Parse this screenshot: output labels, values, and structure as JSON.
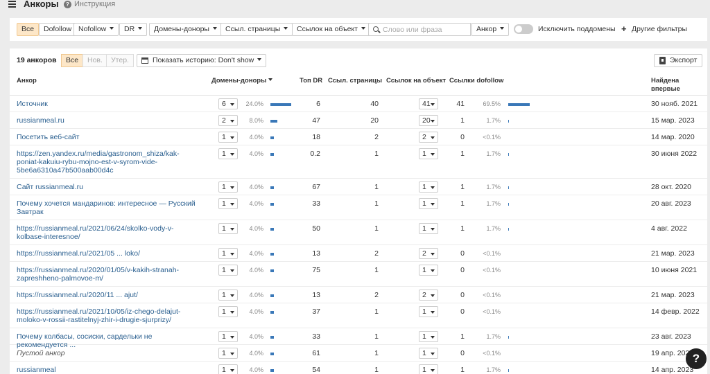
{
  "header": {
    "title": "Анкоры",
    "help_label": "Инструкция"
  },
  "filters": {
    "all": "Все",
    "dofollow": "Dofollow",
    "nofollow": "Nofollow",
    "dr": "DR",
    "ref_domains": "Домены-доноры",
    "ref_pages": "Ссыл. страницы",
    "links_to_target": "Ссылок на объект",
    "search_placeholder": "Слово или фраза",
    "search_value": "",
    "search_mode": "Анкор",
    "exclude_subdomains": "Исключить поддомены",
    "more_filters": "Другие фильтры"
  },
  "toolbar": {
    "count": "19 анкоров",
    "seg_all": "Все",
    "seg_new": "Нов.",
    "seg_lost": "Утер.",
    "history": "Показать историю: Don't show",
    "export": "Экспорт"
  },
  "table": {
    "columns": {
      "anchor": "Анкор",
      "ref_domains": "Домены-доноры",
      "dr": "Топ DR",
      "ref_pages": "Ссыл. страницы",
      "links_to_target": "Ссылок на объект",
      "dofollow": "Ссылки dofollow",
      "first_seen": "Найдена впервые"
    },
    "rows": [
      {
        "anchor": "Источник",
        "domains": "6",
        "domains_pct": "24.0%",
        "domains_frac": 0.24,
        "dr": "6",
        "pages": "40",
        "links": "41",
        "dofollow": "41",
        "dofollow_pct": "69.5%",
        "dofollow_frac": 0.695,
        "date": "30 нояб. 2021"
      },
      {
        "anchor": "russianmeal.ru",
        "domains": "2",
        "domains_pct": "8.0%",
        "domains_frac": 0.08,
        "dr": "47",
        "pages": "20",
        "links": "20",
        "dofollow": "1",
        "dofollow_pct": "1.7%",
        "dofollow_frac": 0.017,
        "date": "15 мар. 2023"
      },
      {
        "anchor": "Посетить веб-сайт",
        "domains": "1",
        "domains_pct": "4.0%",
        "domains_frac": 0.04,
        "dr": "18",
        "pages": "2",
        "links": "2",
        "dofollow": "0",
        "dofollow_pct": "<0.1%",
        "dofollow_frac": 0,
        "date": "14 мар. 2020"
      },
      {
        "anchor": "https://zen.yandex.ru/media/gastronom_shiza/kak-poniat-kakuiu-rybu-mojno-est-v-syrom-vide-5be6a6310a47b500aab00d4c",
        "domains": "1",
        "domains_pct": "4.0%",
        "domains_frac": 0.04,
        "dr": "0.2",
        "pages": "1",
        "links": "1",
        "dofollow": "1",
        "dofollow_pct": "1.7%",
        "dofollow_frac": 0.017,
        "date": "30 июня 2022"
      },
      {
        "anchor": "Сайт russianmeal.ru",
        "domains": "1",
        "domains_pct": "4.0%",
        "domains_frac": 0.04,
        "dr": "67",
        "pages": "1",
        "links": "1",
        "dofollow": "1",
        "dofollow_pct": "1.7%",
        "dofollow_frac": 0.017,
        "date": "28 окт. 2020"
      },
      {
        "anchor": "Почему хочется мандаринов: интересное — Русский Завтрак",
        "domains": "1",
        "domains_pct": "4.0%",
        "domains_frac": 0.04,
        "dr": "33",
        "pages": "1",
        "links": "1",
        "dofollow": "1",
        "dofollow_pct": "1.7%",
        "dofollow_frac": 0.017,
        "date": "20 авг. 2023"
      },
      {
        "anchor": "https://russianmeal.ru/2021/06/24/skolko-vody-v-kolbase-interesnoe/",
        "domains": "1",
        "domains_pct": "4.0%",
        "domains_frac": 0.04,
        "dr": "50",
        "pages": "1",
        "links": "1",
        "dofollow": "1",
        "dofollow_pct": "1.7%",
        "dofollow_frac": 0.017,
        "date": "4 авг. 2022"
      },
      {
        "anchor": "https://russianmeal.ru/2021/05 ... loko/",
        "domains": "1",
        "domains_pct": "4.0%",
        "domains_frac": 0.04,
        "dr": "13",
        "pages": "2",
        "links": "2",
        "dofollow": "0",
        "dofollow_pct": "<0.1%",
        "dofollow_frac": 0,
        "date": "21 мар. 2023"
      },
      {
        "anchor": "https://russianmeal.ru/2020/01/05/v-kakih-stranah-zapreshheno-palmovoe-m/",
        "domains": "1",
        "domains_pct": "4.0%",
        "domains_frac": 0.04,
        "dr": "75",
        "pages": "1",
        "links": "1",
        "dofollow": "0",
        "dofollow_pct": "<0.1%",
        "dofollow_frac": 0,
        "date": "10 июня 2021"
      },
      {
        "anchor": "https://russianmeal.ru/2020/11 ... ajut/",
        "domains": "1",
        "domains_pct": "4.0%",
        "domains_frac": 0.04,
        "dr": "13",
        "pages": "2",
        "links": "2",
        "dofollow": "0",
        "dofollow_pct": "<0.1%",
        "dofollow_frac": 0,
        "date": "21 мар. 2023"
      },
      {
        "anchor": "https://russianmeal.ru/2021/10/05/iz-chego-delajut-moloko-v-rossii-rastitelnyj-zhir-i-drugie-sjurprizy/",
        "domains": "1",
        "domains_pct": "4.0%",
        "domains_frac": 0.04,
        "dr": "37",
        "pages": "1",
        "links": "1",
        "dofollow": "0",
        "dofollow_pct": "<0.1%",
        "dofollow_frac": 0,
        "date": "14 февр. 2022"
      },
      {
        "anchor": "Почему колбасы, сосиски, сардельки не рекомендуется ...",
        "domains": "1",
        "domains_pct": "4.0%",
        "domains_frac": 0.04,
        "dr": "33",
        "pages": "1",
        "links": "1",
        "dofollow": "1",
        "dofollow_pct": "1.7%",
        "dofollow_frac": 0.017,
        "date": "23 авг. 2023"
      },
      {
        "anchor": "Пустой анкор",
        "empty": true,
        "domains": "1",
        "domains_pct": "4.0%",
        "domains_frac": 0.04,
        "dr": "61",
        "pages": "1",
        "links": "1",
        "dofollow": "0",
        "dofollow_pct": "<0.1%",
        "dofollow_frac": 0,
        "date": "19 апр. 2023"
      },
      {
        "anchor": "russianmeal",
        "domains": "1",
        "domains_pct": "4.0%",
        "domains_frac": 0.04,
        "dr": "54",
        "pages": "1",
        "links": "1",
        "dofollow": "1",
        "dofollow_pct": "1.7%",
        "dofollow_frac": 0.017,
        "date": "14 апр. 2023"
      }
    ]
  },
  "help_fab": "?",
  "colors": {
    "accent_bar": "#3a78b8",
    "active_segment": "#fde7c8",
    "link": "#2a5f8f"
  }
}
